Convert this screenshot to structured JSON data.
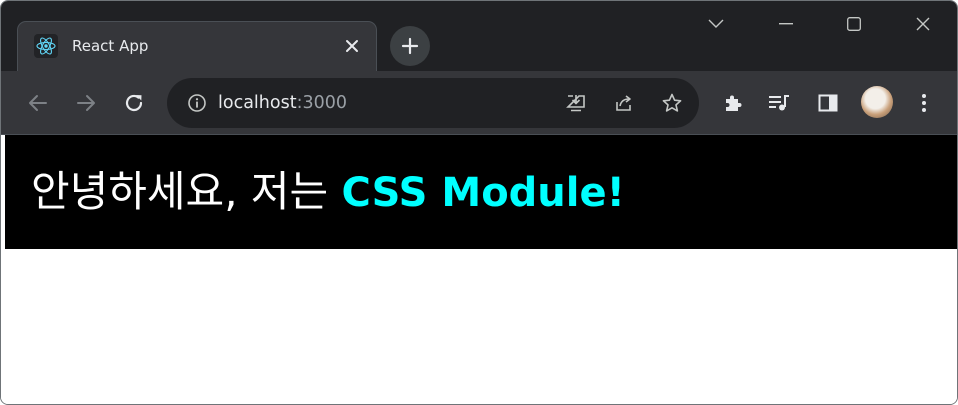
{
  "tab": {
    "title": "React App",
    "favicon": "react-logo-icon"
  },
  "address_bar": {
    "host": "localhost",
    "port": ":3000"
  },
  "page": {
    "greeting": "안녕하세요, 저는 ",
    "highlight": "CSS Module!"
  },
  "colors": {
    "tabstrip_bg": "#202124",
    "toolbar_bg": "#35363a",
    "banner_bg": "#000000",
    "banner_text": "#ffffff",
    "accent": "#00ffff"
  }
}
